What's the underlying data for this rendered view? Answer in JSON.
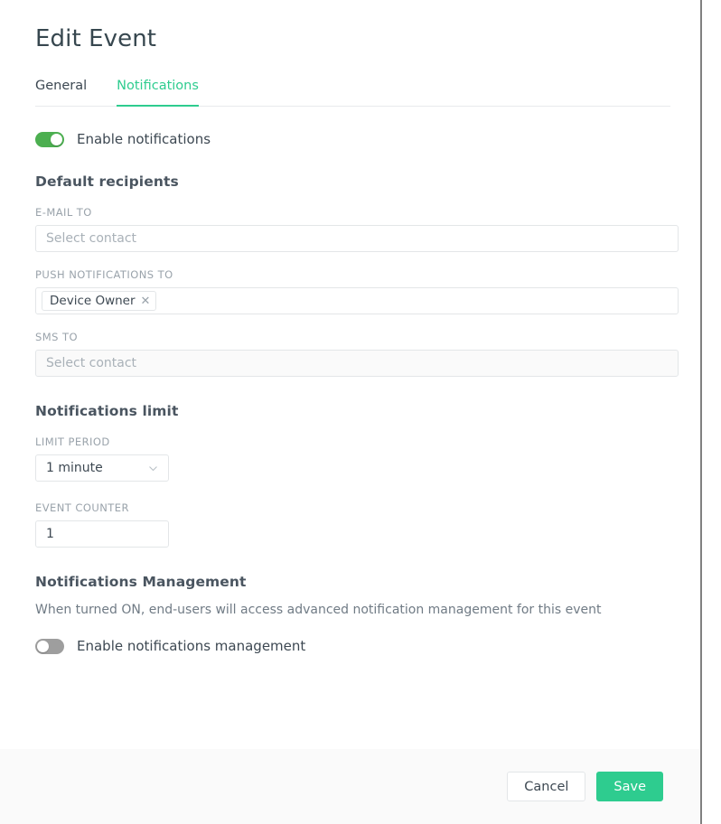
{
  "page": {
    "title": "Edit Event"
  },
  "tabs": [
    {
      "label": "General",
      "active": false
    },
    {
      "label": "Notifications",
      "active": true
    }
  ],
  "enable_notifications": {
    "label": "Enable notifications",
    "state": "on"
  },
  "default_recipients": {
    "heading": "Default recipients",
    "email_to": {
      "label": "E-MAIL TO",
      "placeholder": "Select contact",
      "value": ""
    },
    "push_notifications_to": {
      "label": "PUSH NOTIFICATIONS TO",
      "placeholder": "",
      "chips": [
        {
          "label": "Device Owner",
          "remove_icon": "close-icon"
        }
      ]
    },
    "sms_to": {
      "label": "SMS TO",
      "placeholder": "Select contact",
      "value": "",
      "disabled": true
    }
  },
  "notifications_limit": {
    "heading": "Notifications limit",
    "limit_period": {
      "label": "LIMIT PERIOD",
      "value": "1 minute",
      "icon": "chevron-down-icon"
    },
    "event_counter": {
      "label": "EVENT COUNTER",
      "value": "1"
    }
  },
  "notifications_management": {
    "heading": "Notifications Management",
    "description": "When turned ON, end-users will access advanced notification management for this event",
    "toggle_label": "Enable notifications management",
    "state": "off"
  },
  "footer": {
    "cancel_label": "Cancel",
    "save_label": "Save"
  },
  "colors": {
    "accent": "#2ecc8f",
    "toggle_on": "#4caf50",
    "toggle_off": "#9e9e9e",
    "heading": "#4a5560",
    "label": "#9aa3ab"
  }
}
